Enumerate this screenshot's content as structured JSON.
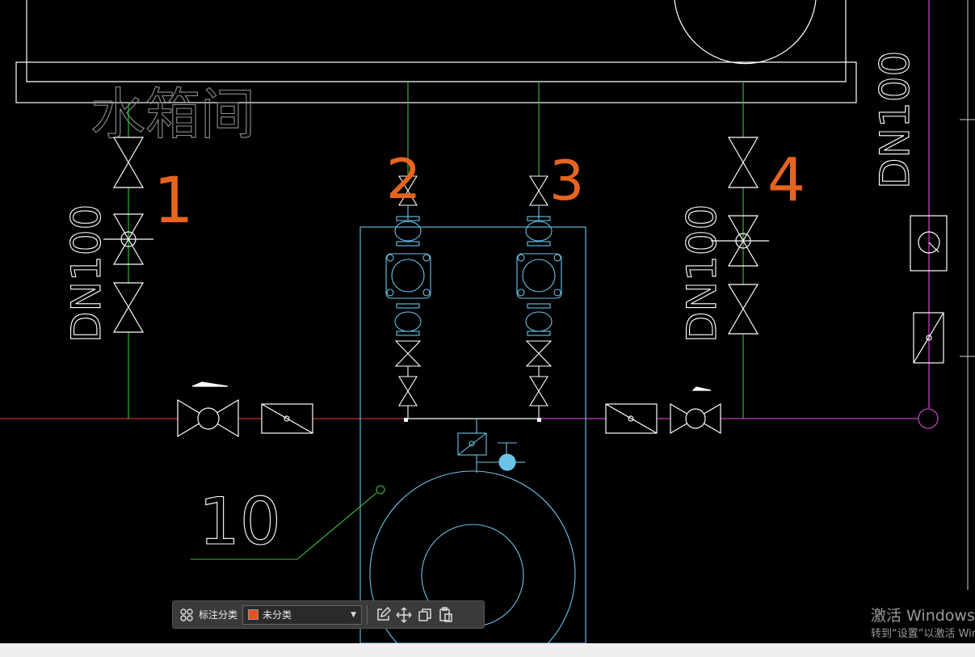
{
  "drawing": {
    "room_label": "水箱间",
    "pipe_label_left": "DN100",
    "pipe_label_mid": "DN100",
    "pipe_label_right": "DN100",
    "callout_number": "10",
    "markup_numbers": [
      "1",
      "2",
      "3",
      "4"
    ],
    "markup_color": "#e8641e"
  },
  "toolbar": {
    "category_label": "标注分类",
    "selected_category": "未分类",
    "selected_color": "#e8511d",
    "icons": [
      "grid-icon",
      "edit-icon",
      "move-icon",
      "copy-icon",
      "paste-icon"
    ]
  },
  "watermark": {
    "title": "激活 Windows",
    "subtitle": "转到“设置”以激活 Windows。"
  }
}
